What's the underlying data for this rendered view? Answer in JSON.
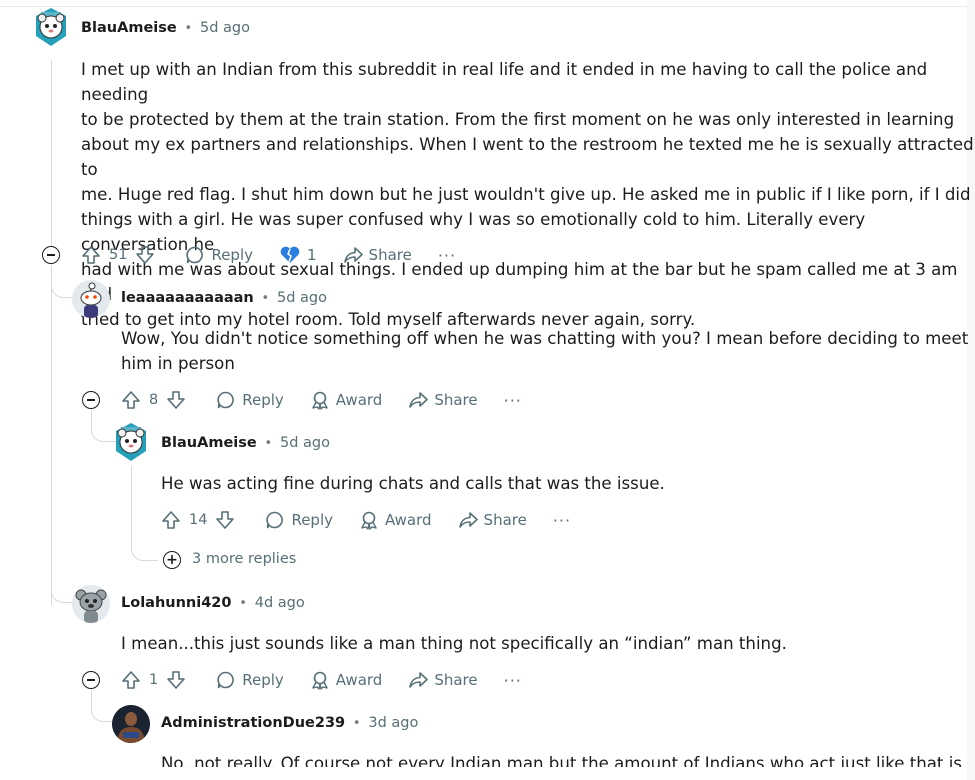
{
  "comments": [
    {
      "user": "BlauAmeise",
      "time": "5d ago",
      "lines": [
        "I met up with an Indian from this subreddit in real life and it ended in me having to call the police and needing",
        "to be protected by them at the train station. From the first moment on he was only interested in learning",
        "about my ex partners and relationships. When I went to the restroom he texted me he is sexually attracted to",
        "me. Huge red flag. I shut him down but he just wouldn't give up. He asked me in public if I like porn, if I did",
        "things with a girl. He was super confused why I was so emotionally cold to him. Literally every conversation he",
        "had with me was about sexual things. I ended up dumping him at the bar but he spam called me at 3 am and",
        "tried to get into my hotel room. Told myself afterwards never again, sorry."
      ],
      "votes": "51",
      "reply": "Reply",
      "award_count": "1",
      "share": "Share",
      "more": "···"
    },
    {
      "user": "leaaaaaaaaaaan",
      "time": "5d ago",
      "lines": [
        "Wow, You didn't notice something off when he was chatting with you? I mean before deciding to meet",
        "him in person"
      ],
      "votes": "8",
      "reply": "Reply",
      "award": "Award",
      "share": "Share",
      "more": "···"
    },
    {
      "user": "BlauAmeise",
      "time": "5d ago",
      "lines": [
        "He was acting fine during chats and calls that was the issue."
      ],
      "votes": "14",
      "reply": "Reply",
      "award": "Award",
      "share": "Share",
      "more": "···"
    },
    {
      "user": "Lolahunni420",
      "time": "4d ago",
      "lines": [
        "I mean...this just sounds like a man thing not specifically an “indian” man thing."
      ],
      "votes": "1",
      "reply": "Reply",
      "award": "Award",
      "share": "Share",
      "more": "···"
    },
    {
      "user": "AdministrationDue239",
      "time": "3d ago",
      "lines": [
        "No, not really. Of course not every Indian man but the amount of Indians who act just like that is"
      ]
    }
  ],
  "more_replies": "3 more replies",
  "dot": "•",
  "colors": {
    "text": "#1c1c1c",
    "meta": "#576f76",
    "thread_line": "#d7dadc",
    "heart": "#2a7de1"
  }
}
